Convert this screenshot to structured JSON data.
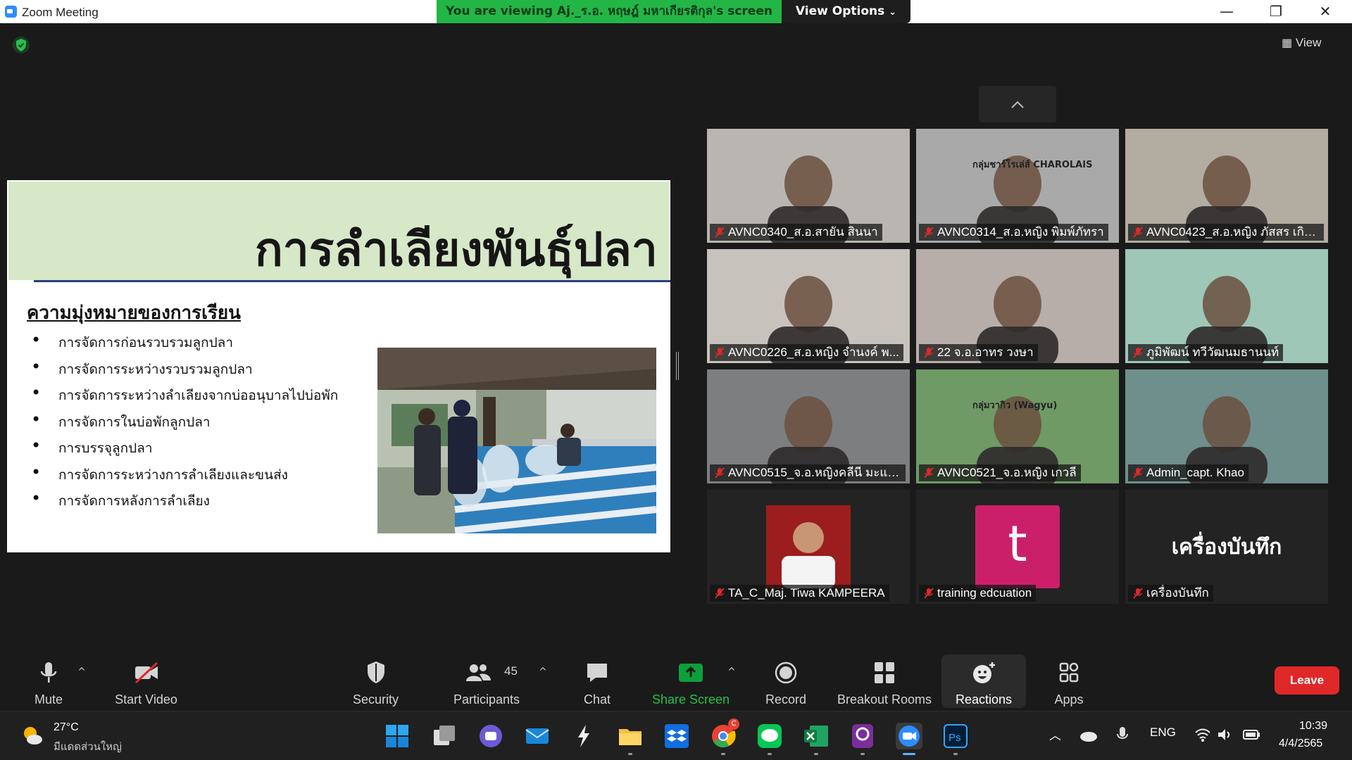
{
  "window": {
    "title": "Zoom Meeting",
    "viewing_banner": "You are viewing Aj._ร.อ. หฤษฎ์ มหาเกียรติกุล's screen",
    "view_options": "View Options",
    "minimize": "—",
    "restore": "❐",
    "close": "✕"
  },
  "overlay": {
    "view_label": "View"
  },
  "slide": {
    "title": "การลำเลียงพันธุ์ปลา",
    "subtitle": "ความมุ่งหมายของการเรียน",
    "bullets": [
      "การจัดการก่อนรวบรวมลูกปลา",
      "การจัดการระหว่างรวบรวมลูกปลา",
      "การจัดการระหว่างลำเลียงจากบ่ออนุบาลไปบ่อพัก",
      "การจัดการในบ่อพักลูกปลา",
      "การบรรจุลูกปลา",
      "การจัดการระหว่างการลำเลียงและขนส่ง",
      "การจัดการหลังการลำเลียง"
    ]
  },
  "participants": [
    {
      "name": "AVNC0340_ส.อ.สายัน สินนา",
      "bg": "#b9b6b1"
    },
    {
      "name": "AVNC0314_ส.อ.หญิง พิมพ์ภัทรา",
      "bg": "#a9a9a9",
      "overlay_text": "กลุ่มชาร์โรเล่ส์ CHAROLAIS"
    },
    {
      "name": "AVNC0423_ส.อ.หญิง ภัสสร เกิด...",
      "bg": "#b3aca0"
    },
    {
      "name": "AVNC0226_ส.อ.หญิง จำนงค์ พ...",
      "bg": "#c7c3bc"
    },
    {
      "name": "22 จ.อ.อาทร วงษา",
      "bg": "#b8aea9"
    },
    {
      "name": "ภูมิพัฒน์ ทวีวัฒนมธานนท์",
      "bg": "#9ec7b8"
    },
    {
      "name": "AVNC0515_จ.อ.หญิงคลีนี มะแซ...",
      "bg": "#7d7e80"
    },
    {
      "name": "AVNC0521_จ.อ.หญิง เกวลี",
      "bg": "#6f9a66",
      "overlay_text": "กลุ่มวากิว (Wagyu)"
    },
    {
      "name": "Admin_capt. Khao",
      "bg": "#6f8f8c"
    },
    {
      "name": "TA_C_Maj. Tiwa KAMPEERA",
      "bg": "#232323"
    },
    {
      "name": "training edcuation",
      "bg": "#232323",
      "avatar_letter": "t",
      "avatar_color": "#cc1f6a"
    },
    {
      "name": "เครื่องบันทึก",
      "bg": "#232323",
      "center_text": "เครื่องบันทึก"
    }
  ],
  "toolbar": {
    "mute": "Mute",
    "start_video": "Start Video",
    "security": "Security",
    "participants": "Participants",
    "participants_count": "45",
    "chat": "Chat",
    "share_screen": "Share Screen",
    "record": "Record",
    "breakout_rooms": "Breakout Rooms",
    "reactions": "Reactions",
    "apps": "Apps",
    "leave": "Leave"
  },
  "taskbar": {
    "temperature": "27°C",
    "weather": "มีแดดส่วนใหญ่",
    "language": "ENG",
    "time": "10:39",
    "date": "4/4/2565",
    "chrome_badge": "C"
  },
  "colors": {
    "accent": "#2d8cff",
    "share_green": "#0e9f3c",
    "leave_red": "#e02828",
    "banner_green": "#24b547"
  }
}
